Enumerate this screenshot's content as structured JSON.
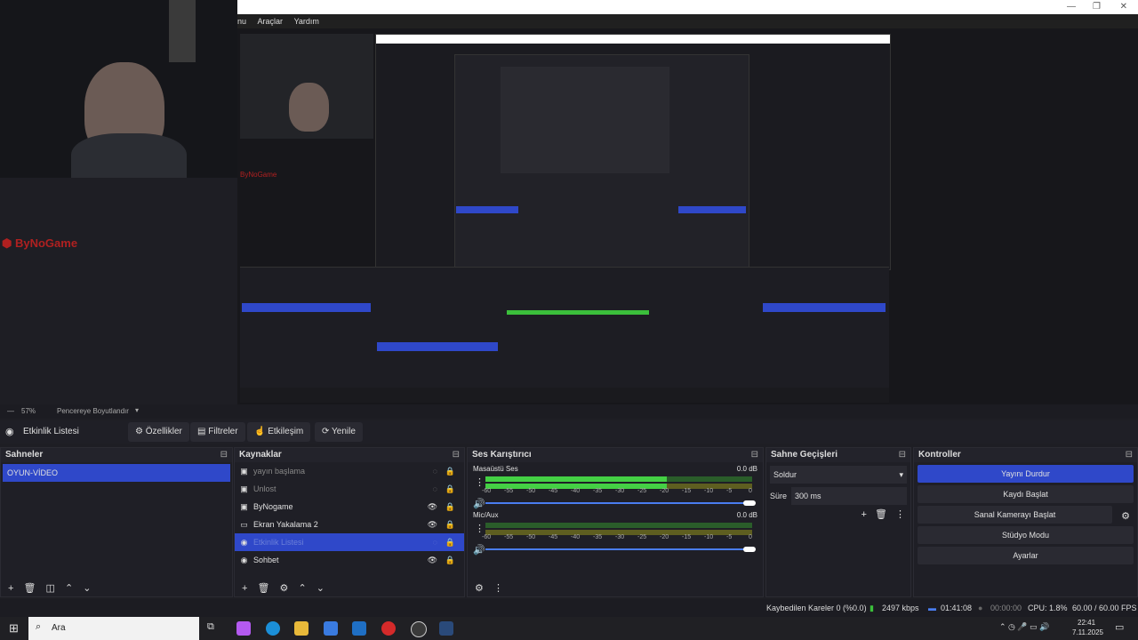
{
  "window": {
    "menu": [
      "nu",
      "Araçlar",
      "Yardım"
    ]
  },
  "overlay": {
    "watermark": "ByNoGame",
    "watermark_small": "ByNoGame"
  },
  "scale_bar": {
    "zoom": "57%",
    "mode": "Pencereye Boyutlandır"
  },
  "toolbar": {
    "active_source": "Etkinlik Listesi",
    "properties": "Özellikler",
    "filters": "Filtreler",
    "interact": "Etkileşim",
    "refresh": "Yenile"
  },
  "scenes": {
    "title": "Sahneler",
    "items": [
      "OYUN-VİDEO"
    ]
  },
  "sources": {
    "title": "Kaynaklar",
    "items": [
      {
        "label": "yayın başlama",
        "icon": "image-icon"
      },
      {
        "label": "Unlost",
        "icon": "image-icon"
      },
      {
        "label": "ByNogame",
        "icon": "image-icon"
      },
      {
        "label": "Ekran Yakalama 2",
        "icon": "monitor-icon"
      },
      {
        "label": "Etkinlik Listesi",
        "icon": "globe-icon"
      },
      {
        "label": "Sohbet",
        "icon": "globe-icon"
      }
    ]
  },
  "mixer": {
    "title": "Ses Karıştırıcı",
    "channels": [
      {
        "name": "Masaüstü Ses",
        "db": "0.0 dB",
        "level": 0.68
      },
      {
        "name": "Mic/Aux",
        "db": "0.0 dB",
        "level": 0.0
      }
    ],
    "ticks": [
      "-60",
      "-55",
      "-50",
      "-45",
      "-40",
      "-35",
      "-30",
      "-25",
      "-20",
      "-15",
      "-10",
      "-5",
      "0"
    ]
  },
  "transitions": {
    "title": "Sahne Geçişleri",
    "selected": "Soldur",
    "duration_label": "Süre",
    "duration_value": "300 ms"
  },
  "controls": {
    "title": "Kontroller",
    "stop_stream": "Yayını Durdur",
    "start_recording": "Kaydı Başlat",
    "start_virtualcam": "Sanal Kamerayı Başlat",
    "studio_mode": "Stüdyo Modu",
    "settings": "Ayarlar"
  },
  "status": {
    "dropped": "Kaybedilen Kareler 0 (%0.0)",
    "bitrate": "2497 kbps",
    "live_time": "01:41:08",
    "rec_time": "00:00:00",
    "cpu": "CPU: 1.8%",
    "fps": "60.00 / 60.00 FPS"
  },
  "taskbar": {
    "search": "Ara",
    "time": "22:41",
    "date": "7.11.2025"
  }
}
